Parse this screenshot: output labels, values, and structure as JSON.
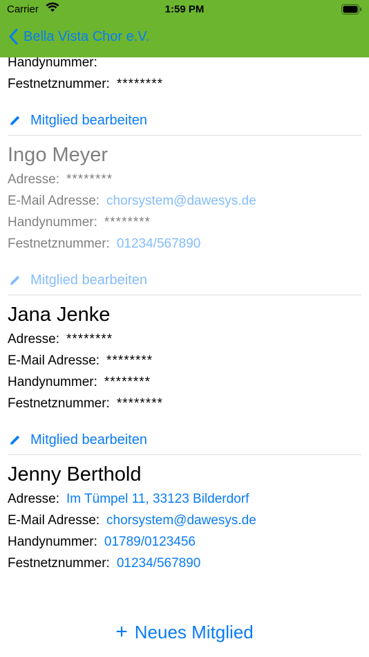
{
  "status": {
    "carrier": "Carrier",
    "time": "1:59 PM"
  },
  "nav": {
    "back_label": "Bella Vista Chor e.V."
  },
  "partial": {
    "hidden_label": "Handynummer:",
    "festnetz_label": "Festnetznummer:",
    "festnetz_value": "********",
    "edit_label": "Mitglied bearbeiten"
  },
  "members": [
    {
      "name": "Ingo Meyer",
      "address_label": "Adresse:",
      "address_value": "********",
      "email_label": "E-Mail Adresse:",
      "email_value": "chorsystem@dawesys.de",
      "mobile_label": "Handynummer:",
      "mobile_value": "********",
      "phone_label": "Festnetznummer:",
      "phone_value": "01234/567890",
      "edit_label": "Mitglied bearbeiten"
    },
    {
      "name": "Jana Jenke",
      "address_label": "Adresse:",
      "address_value": "********",
      "email_label": "E-Mail Adresse:",
      "email_value": "********",
      "mobile_label": "Handynummer:",
      "mobile_value": "********",
      "phone_label": "Festnetznummer:",
      "phone_value": "********",
      "edit_label": "Mitglied bearbeiten"
    },
    {
      "name": "Jenny Berthold",
      "address_label": "Adresse:",
      "address_value": "Im Tümpel 11, 33123 Bilderdorf",
      "email_label": "E-Mail Adresse:",
      "email_value": "chorsystem@dawesys.de",
      "mobile_label": "Handynummer:",
      "mobile_value": "01789/0123456",
      "phone_label": "Festnetznummer:",
      "phone_value": "01234/567890"
    }
  ],
  "add_button": {
    "label": "Neues Mitglied"
  },
  "colors": {
    "nav_bg": "#6cb52f",
    "accent": "#0a7cf5"
  }
}
